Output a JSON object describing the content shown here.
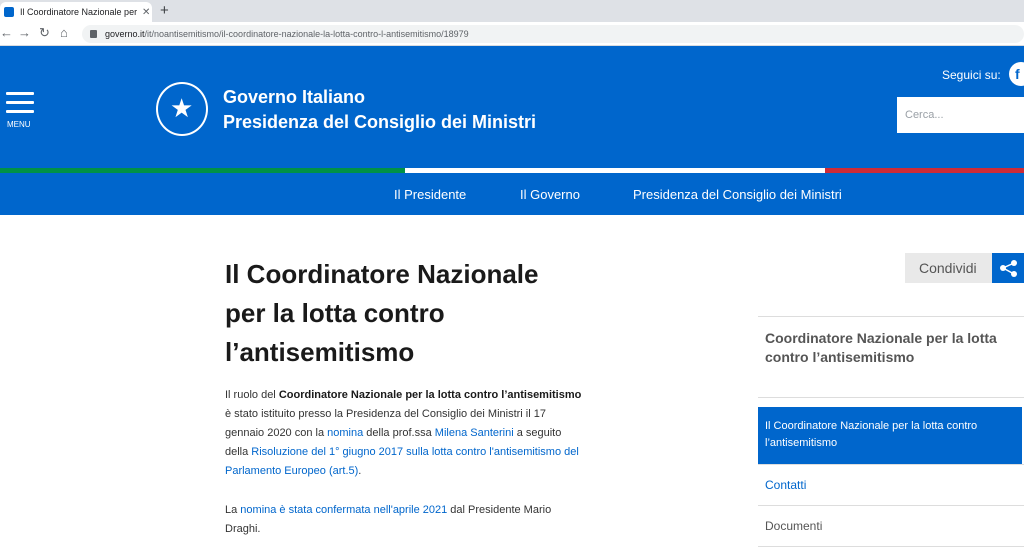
{
  "browser": {
    "tab_title": "Il Coordinatore Nazionale per la lotta contro l'antisemitismo",
    "tab_close": "✕",
    "new_tab": "+",
    "url_host": "governo.it",
    "url_path": "/it/noantisemitismo/il-coordinatore-nazionale-la-lotta-contro-l-antisemitismo/18979"
  },
  "header": {
    "menu_label": "MENU",
    "brand_line1": "Governo Italiano",
    "brand_line2": "Presidenza del Consiglio dei Ministri",
    "follow_label": "Seguici su:",
    "facebook_glyph": "f",
    "search_placeholder": "Cerca..."
  },
  "colors": {
    "brand_blue": "#0066cc",
    "flag_green": "#009246",
    "flag_white": "#ffffff",
    "flag_red": "#ce2b37"
  },
  "nav": {
    "items": [
      "Il Presidente",
      "Il Governo",
      "Presidenza del Consiglio dei Ministri"
    ]
  },
  "article": {
    "title": "Il Coordinatore Nazionale per la lotta contro l’antisemitismo",
    "p1": [
      {
        "t": "Il ruolo del ",
        "s": "text"
      },
      {
        "t": "Coordinatore Nazionale per la lotta contro l’antisemitismo",
        "s": "bold"
      },
      {
        "t": " è stato istituito presso la Presidenza del Consiglio dei Ministri il 17 gennaio 2020 con la ",
        "s": "text"
      },
      {
        "t": "nomina",
        "s": "link"
      },
      {
        "t": " della prof.ssa ",
        "s": "text"
      },
      {
        "t": "Milena Santerini",
        "s": "link"
      },
      {
        "t": " a seguito della ",
        "s": "text"
      },
      {
        "t": "Risoluzione del 1° giugno 2017 sulla lotta contro l'antisemitismo del Parlamento Europeo (art.5)",
        "s": "link"
      },
      {
        "t": ".",
        "s": "text"
      }
    ],
    "p2": [
      {
        "t": "La ",
        "s": "text"
      },
      {
        "t": "nomina è stata confermata nell'aprile 2021",
        "s": "link"
      },
      {
        "t": " dal Presidente Mario Draghi.",
        "s": "text"
      }
    ]
  },
  "share": {
    "label": "Condividi",
    "icon": "share-icon"
  },
  "sidebar": {
    "heading": "Coordinatore Nazionale per la lotta contro l’antisemitismo",
    "active_item": "Il Coordinatore Nazionale per la lotta contro l’antisemitismo",
    "items": [
      "Contatti",
      "Documenti"
    ]
  }
}
